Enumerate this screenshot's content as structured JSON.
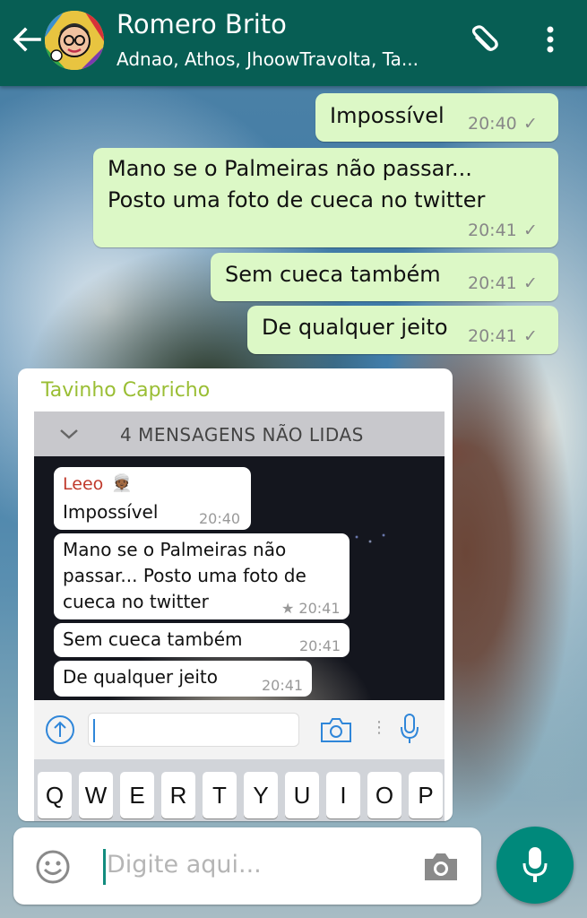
{
  "header": {
    "title": "Romero Brito",
    "subtitle": "Adnao, Athos, JhoowTravolta, Ta..."
  },
  "messages_out": [
    {
      "text": "Impossível",
      "time": "20:40",
      "status": "✓"
    },
    {
      "line1": "Mano se o Palmeiras não passar...",
      "line2": "Posto uma foto de cueca no twitter",
      "time": "20:41",
      "status": "✓"
    },
    {
      "text": "Sem cueca também",
      "time": "20:41",
      "status": "✓"
    },
    {
      "text": "De qualquer jeito",
      "time": "20:41",
      "status": "✓"
    }
  ],
  "message_in": {
    "sender": "Tavinho Capricho",
    "sender_color": "#9abe34",
    "screenshot": {
      "unread_banner": "4 MENSAGENS NÃO LIDAS",
      "bubbles": [
        {
          "sender": "Leeo",
          "text": "Impossível",
          "time": "20:40"
        },
        {
          "line1": "Mano se o Palmeiras não",
          "line2": "passar... Posto uma foto de",
          "line3": "cueca no twitter",
          "time": "★ 20:41"
        },
        {
          "text": "Sem cueca também",
          "time": "20:41"
        },
        {
          "text": "De qualquer jeito",
          "time": "20:41"
        }
      ],
      "keyboard_row": [
        "Q",
        "W",
        "E",
        "R",
        "T",
        "Y",
        "U",
        "I",
        "O",
        "P"
      ]
    }
  },
  "composer": {
    "placeholder": "Digite aqui..."
  },
  "colors": {
    "header": "#075e54",
    "outgoing_bubble": "#dcf8c6",
    "mic_button": "#00897b"
  }
}
